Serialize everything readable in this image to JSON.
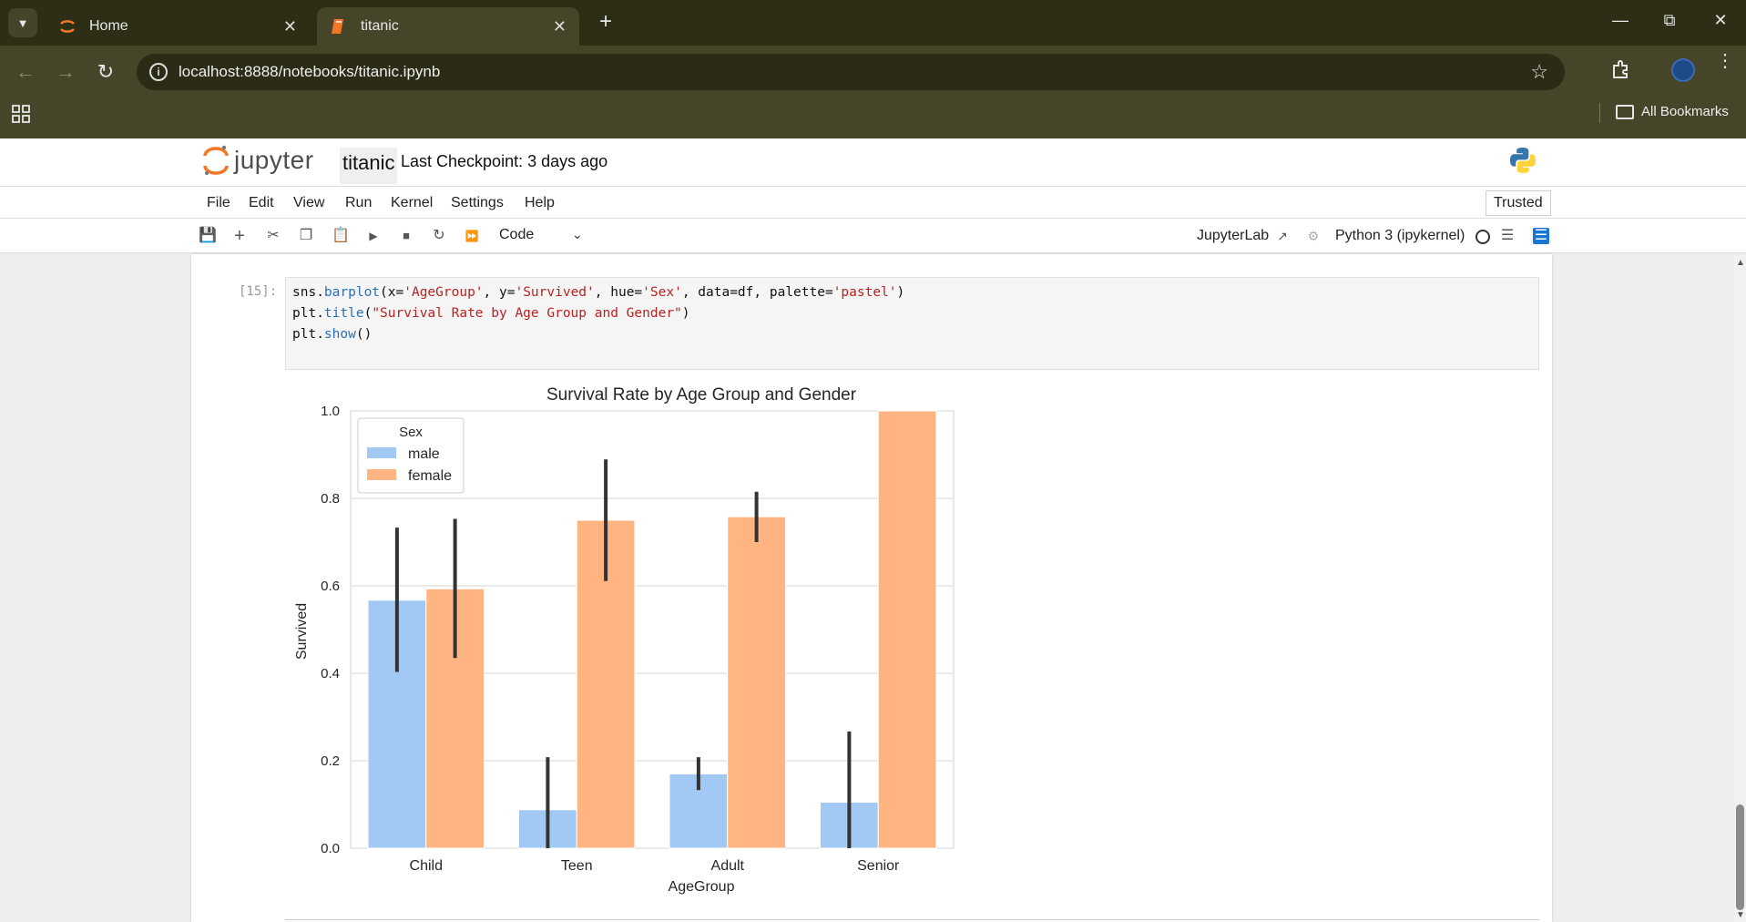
{
  "browser": {
    "tabs": [
      {
        "label": "Home"
      },
      {
        "label": "titanic"
      }
    ],
    "url": "localhost:8888/notebooks/titanic.ipynb",
    "bookmarks_label": "All Bookmarks"
  },
  "jupyter": {
    "logo_text": "jupyter",
    "notebook_name": "titanic",
    "checkpoint": "Last Checkpoint: 3 days ago",
    "menu": [
      "File",
      "Edit",
      "View",
      "Run",
      "Kernel",
      "Settings",
      "Help"
    ],
    "trusted": "Trusted",
    "cell_type": "Code",
    "jupyterlab_link": "JupyterLab",
    "kernel": "Python 3 (ipykernel)"
  },
  "cell": {
    "prompt": "[15]:",
    "code": [
      "sns.barplot(x='AgeGroup', y='Survived', hue='Sex', data=df, palette='pastel')",
      "plt.title(\"Survival Rate by Age Group and Gender\")",
      "plt.show()"
    ]
  },
  "colors": {
    "male": "#a1c9f4",
    "female": "#ffb482",
    "errorbar": "#333333"
  },
  "chart_data": {
    "type": "bar",
    "title": "Survival Rate by Age Group and Gender",
    "xlabel": "AgeGroup",
    "ylabel": "Survived",
    "ylim": [
      0,
      1.0
    ],
    "yticks": [
      0.0,
      0.2,
      0.4,
      0.6,
      0.8,
      1.0
    ],
    "ytick_labels": [
      "0.0",
      "0.2",
      "0.4",
      "0.6",
      "0.8",
      "1.0"
    ],
    "categories": [
      "Child",
      "Teen",
      "Adult",
      "Senior"
    ],
    "grid": true,
    "legend": {
      "title": "Sex",
      "position": "upper left"
    },
    "series": [
      {
        "name": "male",
        "values": [
          0.567,
          0.088,
          0.17,
          0.105
        ],
        "ci_low": [
          0.403,
          0.0,
          0.133,
          0.0
        ],
        "ci_high": [
          0.733,
          0.208,
          0.208,
          0.267
        ]
      },
      {
        "name": "female",
        "values": [
          0.593,
          0.75,
          0.758,
          1.0
        ],
        "ci_low": [
          0.435,
          0.611,
          0.7,
          1.0
        ],
        "ci_high": [
          0.753,
          0.889,
          0.815,
          1.0
        ]
      }
    ]
  }
}
